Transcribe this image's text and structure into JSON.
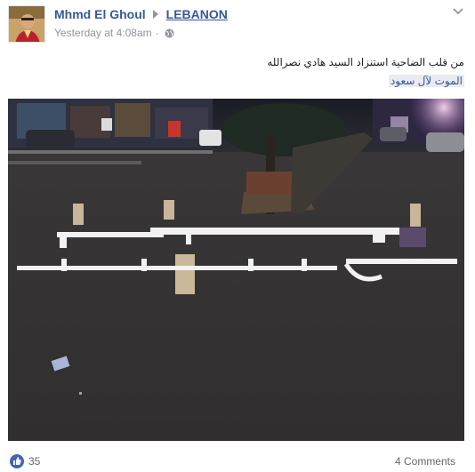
{
  "post": {
    "author": "Mhmd El Ghoul",
    "page": "LEBANON",
    "timestamp": "Yesterday at 4:08am",
    "separator": "·",
    "privacy_icon": "globe-icon",
    "menu_icon": "chevron-down-icon",
    "text_line1": "من قلب الضاحية استنزاد السيد هادي نصرالله",
    "text_line2": "الموت لآل سعود",
    "photo": {
      "road_text_line1": "الموت",
      "road_text_line2": "لآل سعود"
    }
  },
  "footer": {
    "like_icon": "thumbs-up-icon",
    "like_count": "35",
    "comments": "4 Comments"
  },
  "colors": {
    "link": "#365899",
    "meta": "#90949c",
    "like_badge": "#4267b2"
  }
}
